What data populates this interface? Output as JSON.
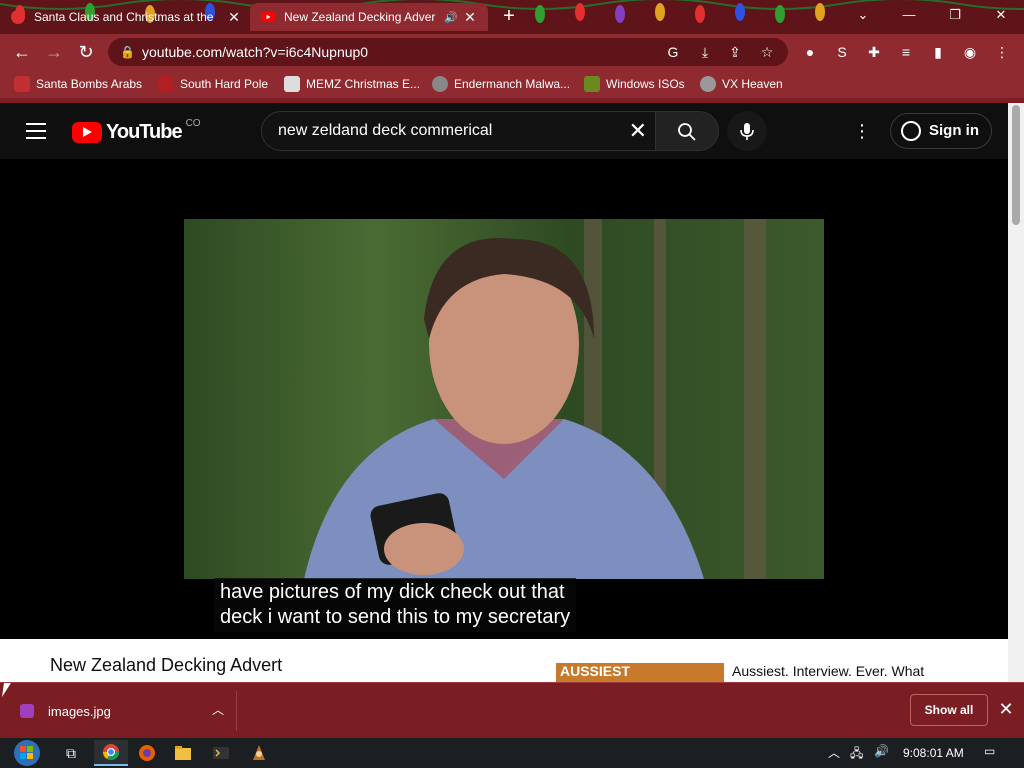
{
  "browser": {
    "tabs": [
      {
        "title": "Santa Claus and Christmas at the",
        "active": false,
        "audio": false
      },
      {
        "title": "New Zealand Decking Adver",
        "active": true,
        "audio": true
      }
    ],
    "address": "youtube.com/watch?v=i6c4Nupnup0",
    "bookmarks": [
      {
        "label": "Santa Bombs Arabs",
        "icon": "santa-icon"
      },
      {
        "label": "South Hard Pole",
        "icon": "star-icon"
      },
      {
        "label": "MEMZ Christmas E...",
        "icon": "page-icon"
      },
      {
        "label": "Endermanch Malwa...",
        "icon": "skull-icon"
      },
      {
        "label": "Windows ISOs",
        "icon": "tree-icon"
      },
      {
        "label": "VX Heaven",
        "icon": "biohazard-icon"
      }
    ],
    "accent": "#8f2a30"
  },
  "youtube": {
    "logo_text": "YouTube",
    "region": "CO",
    "search_value": "new zeldand deck commerical",
    "signin_label": "Sign in",
    "caption_line1": "have pictures of my dick check out that",
    "caption_line2": "deck i want to send this to my secretary",
    "video_title": "New Zealand Decking Advert",
    "rec_thumb_label": "AUSSIEST",
    "rec_title": "Aussiest. Interview. Ever. What"
  },
  "downloads": {
    "file": "images.jpg",
    "show_all": "Show all"
  },
  "taskbar": {
    "clock": "9:08:01 AM"
  }
}
